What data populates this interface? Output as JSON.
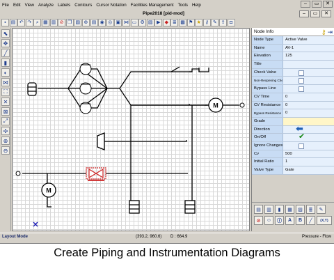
{
  "menu": [
    "File",
    "Edit",
    "View",
    "Analyze",
    "Labels",
    "Contours",
    "Cursor Notation",
    "Facilities Management",
    "Tools",
    "Help"
  ],
  "window": {
    "title": "Pipe2018  [pid-mod]",
    "min": "–",
    "restore": "▭",
    "close": "✕"
  },
  "node_info": {
    "title": "Node Info",
    "rows": [
      {
        "label": "Node Type",
        "value": "Active Valve"
      },
      {
        "label": "Name",
        "value": "AV-1"
      },
      {
        "label": "Elevation",
        "value": "125"
      },
      {
        "label": "Title",
        "value": ""
      },
      {
        "label": "Check Valve",
        "value": "",
        "checkbox": true
      },
      {
        "label": "Non-Reopening Che",
        "value": "",
        "checkbox": true,
        "small": true
      },
      {
        "label": "Bypass Line",
        "value": "",
        "checkbox": true
      },
      {
        "label": "CV Time",
        "value": "0"
      },
      {
        "label": "CV Resistance",
        "value": "0"
      },
      {
        "label": "Bypass Resistance",
        "value": "0",
        "small": true
      },
      {
        "label": "Grade",
        "value": ""
      },
      {
        "label": "Direction",
        "value": "",
        "icon": "left-arrow-icon"
      },
      {
        "label": "On/Off",
        "value": "",
        "icon": "checkmark-icon"
      },
      {
        "label": "Ignore Changes",
        "value": "",
        "checkbox": true
      },
      {
        "label": "Cv",
        "value": "500"
      },
      {
        "label": "Initial Ratio",
        "value": "1"
      },
      {
        "label": "Valve Type",
        "value": "Gate"
      }
    ]
  },
  "diagram": {
    "motor_label": "M"
  },
  "panel_tools": {
    "a": "A",
    "b": "B",
    "xy": "(X,Y)"
  },
  "status": {
    "mode": "Layout Mode",
    "coord": "(393.2, 960.6)",
    "d": "D : 664.9",
    "right": "Pressure - Flow"
  },
  "caption": "Create Piping and Instrumentation Diagrams",
  "colors": {
    "accent_blue": "#1e5fb4",
    "valve_red": "#cc2222",
    "panel_label": "#c8dcf4",
    "panel_value": "#e6f0fc",
    "check_green": "#1c8a1c"
  }
}
